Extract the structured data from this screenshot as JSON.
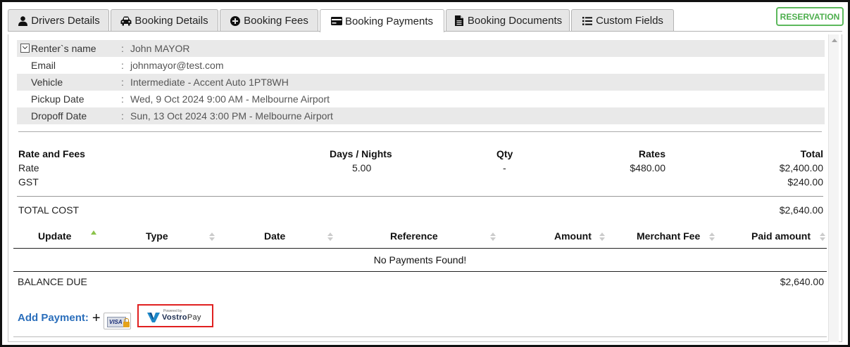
{
  "tabs": [
    {
      "label": "Drivers Details",
      "icon": "user-icon"
    },
    {
      "label": "Booking Details",
      "icon": "car-icon"
    },
    {
      "label": "Booking Fees",
      "icon": "plus-circle-icon"
    },
    {
      "label": "Booking Payments",
      "icon": "credit-card-icon",
      "active": true
    },
    {
      "label": "Booking Documents",
      "icon": "document-icon"
    },
    {
      "label": "Custom Fields",
      "icon": "list-icon"
    }
  ],
  "badge": {
    "label": "RESERVATION",
    "color": "#5cb85c"
  },
  "renter": {
    "rows": [
      {
        "label": "Renter`s name",
        "value": "John MAYOR"
      },
      {
        "label": "Email",
        "value": "johnmayor@test.com"
      },
      {
        "label": "Vehicle",
        "value": "Intermediate - Accent Auto 1PT8WH"
      },
      {
        "label": "Pickup Date",
        "value": "Wed, 9 Oct 2024 9:00 AM - Melbourne Airport"
      },
      {
        "label": "Dropoff Date",
        "value": "Sun, 13 Oct 2024 3:00 PM - Melbourne Airport"
      }
    ],
    "separator": ":"
  },
  "fees": {
    "headers": {
      "name": "Rate and Fees",
      "days": "Days / Nights",
      "qty": "Qty",
      "rates": "Rates",
      "total": "Total"
    },
    "rows": [
      {
        "name": "Rate",
        "days": "5.00",
        "qty": "-",
        "rates": "$480.00",
        "total": "$2,400.00"
      },
      {
        "name": "GST",
        "days": "",
        "qty": "",
        "rates": "",
        "total": "$240.00"
      }
    ],
    "total_label": "TOTAL COST",
    "total_value": "$2,640.00"
  },
  "payments": {
    "headers": [
      "Update",
      "Type",
      "Date",
      "Reference",
      "Amount",
      "Merchant Fee",
      "Paid amount"
    ],
    "empty": "No Payments Found!",
    "balance_label": "BALANCE DUE",
    "balance_value": "$2,640.00"
  },
  "add_payment": {
    "label": "Add Payment:",
    "plus": "+",
    "visa_text": "VISA",
    "vostro_powered": "Powered by",
    "vostro_brand_a": "Vostro",
    "vostro_brand_b": "Pay"
  },
  "colors": {
    "accent_link": "#2a6ebb",
    "highlight_border": "#e02020",
    "sort_active": "#8bc34a"
  }
}
